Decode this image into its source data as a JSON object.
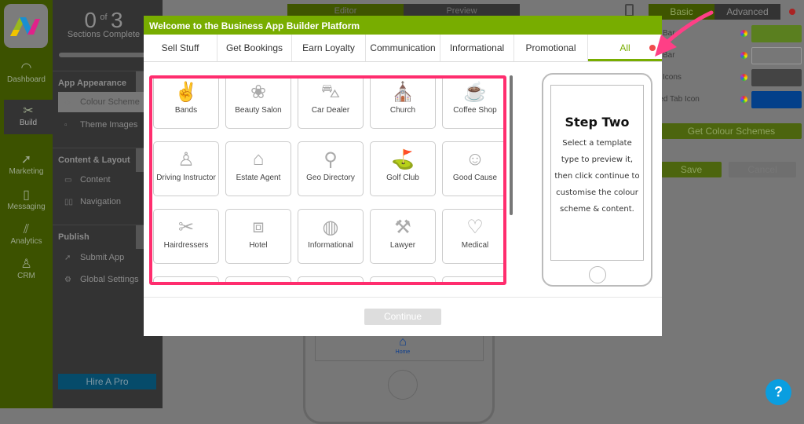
{
  "leftnav": {
    "items": [
      {
        "label": "Dashboard",
        "icon": "speedometer-icon"
      },
      {
        "label": "Build",
        "icon": "tools-icon",
        "active": true
      },
      {
        "label": "Marketing",
        "icon": "rocket-icon"
      },
      {
        "label": "Messaging",
        "icon": "phone-chat-icon"
      },
      {
        "label": "Analytics",
        "icon": "chart-icon"
      },
      {
        "label": "CRM",
        "icon": "person-icon"
      }
    ]
  },
  "progress": {
    "done": "0",
    "of": "of",
    "total": "3",
    "label": "Sections Complete",
    "fraction": 0
  },
  "sections": [
    {
      "title": "App Appearance",
      "items": [
        "Colour Scheme",
        "Theme Images"
      ]
    },
    {
      "title": "Content & Layout",
      "items": [
        "Content",
        "Navigation"
      ]
    },
    {
      "title": "Publish",
      "items": [
        "Submit App",
        "Global Settings"
      ]
    }
  ],
  "hire_pro": "Hire A Pro",
  "editor_tabs": {
    "editor": "Editor",
    "preview": "Preview"
  },
  "right_panel": {
    "tabs": {
      "basic": "Basic",
      "advanced": "Advanced"
    },
    "colors": [
      {
        "label": "Bar",
        "value": "#5a7f1f"
      },
      {
        "label": "Bar",
        "value": "#777777"
      },
      {
        "label": "Icons",
        "value": "#444444"
      },
      {
        "label": "ected Tab Icon",
        "value": "#03408a"
      }
    ],
    "get_schemes": "Get Colour Schemes",
    "save": "Save",
    "cancel": "Cancel"
  },
  "bg_phone": {
    "home_label": "Home"
  },
  "modal": {
    "title": "Welcome to the Business App Builder Platform",
    "tabs": [
      "Sell Stuff",
      "Get Bookings",
      "Earn Loyalty",
      "Communication",
      "Informational",
      "Promotional",
      "All"
    ],
    "active_tab": "All",
    "templates": [
      "Bands",
      "Beauty Salon",
      "Car Dealer",
      "Church",
      "Coffee Shop",
      "Driving Instructor",
      "Estate Agent",
      "Geo Directory",
      "Golf Club",
      "Good Cause",
      "Hairdressers",
      "Hotel",
      "Informational",
      "Lawyer",
      "Medical",
      "",
      "",
      "",
      "",
      ""
    ],
    "preview": {
      "heading": "Step Two",
      "text": "Select a template type to preview it, then click continue to customise the colour scheme & content."
    },
    "continue": "Continue"
  },
  "help": "?"
}
